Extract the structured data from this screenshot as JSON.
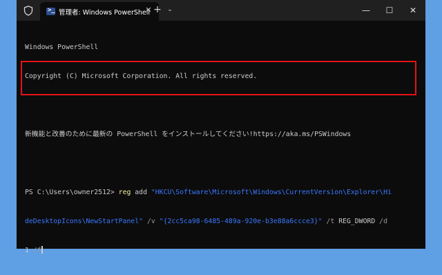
{
  "tab": {
    "title": "管理者: Windows PowerShell",
    "close_glyph": "✕"
  },
  "titlebar": {
    "new_tab": "+",
    "dropdown": "⌄",
    "minimize": "—",
    "maximize": "☐",
    "close": "✕"
  },
  "terminal": {
    "banner_line1": "Windows PowerShell",
    "banner_line2": "Copyright (C) Microsoft Corporation. All rights reserved.",
    "install_notice": "新機能と改善のために最新の PowerShell をインストールしてください!https://aka.ms/PSWindows",
    "prompt": "PS C:\\Users\\owner2512> ",
    "cmd_name": "reg",
    "cmd_sub": " add ",
    "key_path_part1": "\"HKCU\\Software\\Microsoft\\Windows\\CurrentVersion\\Explorer\\Hi",
    "key_path_part2": "deDesktopIcons\\NewStartPanel\"",
    "flag_v": " /v ",
    "value_name": "\"{2cc5ca98-6485-489a-920e-b3e88a6ccce3}\"",
    "flag_t": " /t ",
    "type_value": "REG_DWORD",
    "flag_d": " /d",
    "data_value": "1",
    "flag_f": " /f"
  },
  "colors": {
    "accent_highlight": "#e5131a",
    "desktop": "#5f9fe4",
    "terminal_bg": "#0c0c0c"
  },
  "icons": [
    "shield-icon",
    "powershell-icon",
    "close-icon",
    "plus-icon",
    "chevron-down-icon",
    "minimize-icon",
    "maximize-icon",
    "close-window-icon"
  ]
}
